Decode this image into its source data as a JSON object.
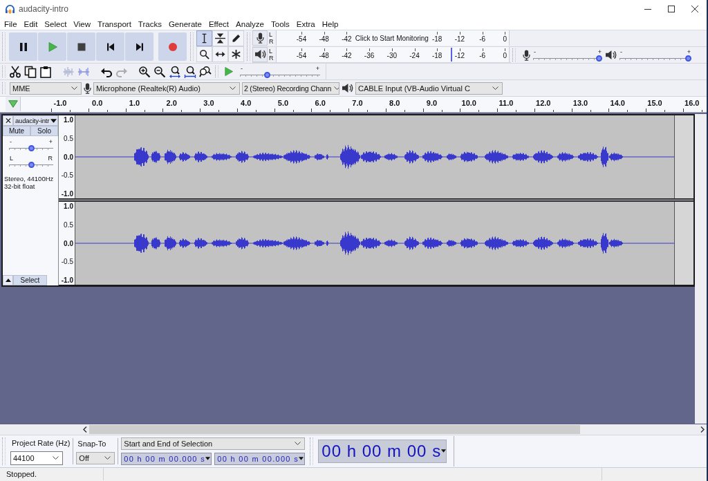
{
  "window": {
    "title": "audacity-intro"
  },
  "menu": [
    "File",
    "Edit",
    "Select",
    "View",
    "Transport",
    "Tracks",
    "Generate",
    "Effect",
    "Analyze",
    "Tools",
    "Extra",
    "Help"
  ],
  "tools": [
    {
      "kind": "select",
      "selected": true
    },
    {
      "kind": "envelope",
      "selected": false
    },
    {
      "kind": "draw",
      "selected": false
    },
    {
      "kind": "zoom",
      "selected": false
    },
    {
      "kind": "time_shift",
      "selected": false
    },
    {
      "kind": "multi",
      "selected": false
    }
  ],
  "record_meter": {
    "channels": [
      "L",
      "R"
    ],
    "ticks_before": [
      "-54",
      "-48",
      "-42"
    ],
    "message": "Click to Start Monitoring",
    "ticks_after": [
      "-18",
      "-12",
      "-6",
      "0"
    ]
  },
  "playback_meter": {
    "channels": [
      "L",
      "R"
    ],
    "ticks": [
      "-54",
      "-48",
      "-42",
      "-36",
      "-30",
      "-24",
      "-18",
      "-12",
      "-6",
      "0"
    ],
    "level": 0.75
  },
  "mixer": {
    "recording": {
      "min_label": "-",
      "max_label": "+",
      "level": 1
    },
    "playback": {
      "min_label": "-",
      "max_label": "+",
      "level": 1
    }
  },
  "edit_buttons": [
    {
      "kind": "cut",
      "disabled": false
    },
    {
      "kind": "copy",
      "disabled": false
    },
    {
      "kind": "paste",
      "disabled": false
    },
    {
      "kind": "trim",
      "disabled": true
    },
    {
      "kind": "silence",
      "disabled": true
    },
    {
      "kind": "undo",
      "disabled": false
    },
    {
      "kind": "redo",
      "disabled": true
    },
    {
      "kind": "zoom_in",
      "disabled": false
    },
    {
      "kind": "zoom_out",
      "disabled": false
    },
    {
      "kind": "fit_selection",
      "disabled": false
    },
    {
      "kind": "fit_project",
      "disabled": false
    },
    {
      "kind": "zoom_toggle",
      "disabled": false
    }
  ],
  "play_at_speed": {
    "min_label": "-",
    "max_label": "+",
    "level": 0.33
  },
  "devices": {
    "host": "MME",
    "recording_device": "Microphone (Realtek(R) Audio)",
    "channels": "2 (Stereo) Recording Chann",
    "playback_device": "CABLE Input (VB-Audio Virtual C"
  },
  "timeline": {
    "labels": [
      "-1.0",
      "0.0",
      "1.0",
      "2.0",
      "3.0",
      "4.0",
      "5.0",
      "6.0",
      "7.0",
      "8.0",
      "9.0",
      "10.0",
      "11.0",
      "12.0",
      "13.0",
      "14.0",
      "15.0",
      "16.0"
    ]
  },
  "track": {
    "name": "audacity-intr",
    "mute": "Mute",
    "solo": "Solo",
    "gain": {
      "min_label": "-",
      "max_label": "+",
      "level": 0.5
    },
    "pan": {
      "min_label": "L",
      "max_label": "R",
      "level": 0.5
    },
    "info": [
      "Stereo, 44100Hz",
      "32-bit float"
    ],
    "select": "Select",
    "channels": [
      {
        "scale": [
          "1.0",
          "0.5",
          "0.0",
          "-0.5",
          "-1.0"
        ]
      },
      {
        "scale": [
          "1.0",
          "0.5",
          "0.0",
          "-0.5",
          "-1.0"
        ]
      }
    ]
  },
  "selection_toolbar": {
    "rate_label": "Project Rate (Hz)",
    "rate": "44100",
    "snap_label": "Snap-To",
    "snap": "Off",
    "mode": "Start and End of Selection",
    "start": "00 h 00 m 00.000 s",
    "end": "00 h 00 m 00.000 s"
  },
  "time_display": "00 h 00 m 00 s",
  "status_bar": {
    "text": "Stopped."
  }
}
